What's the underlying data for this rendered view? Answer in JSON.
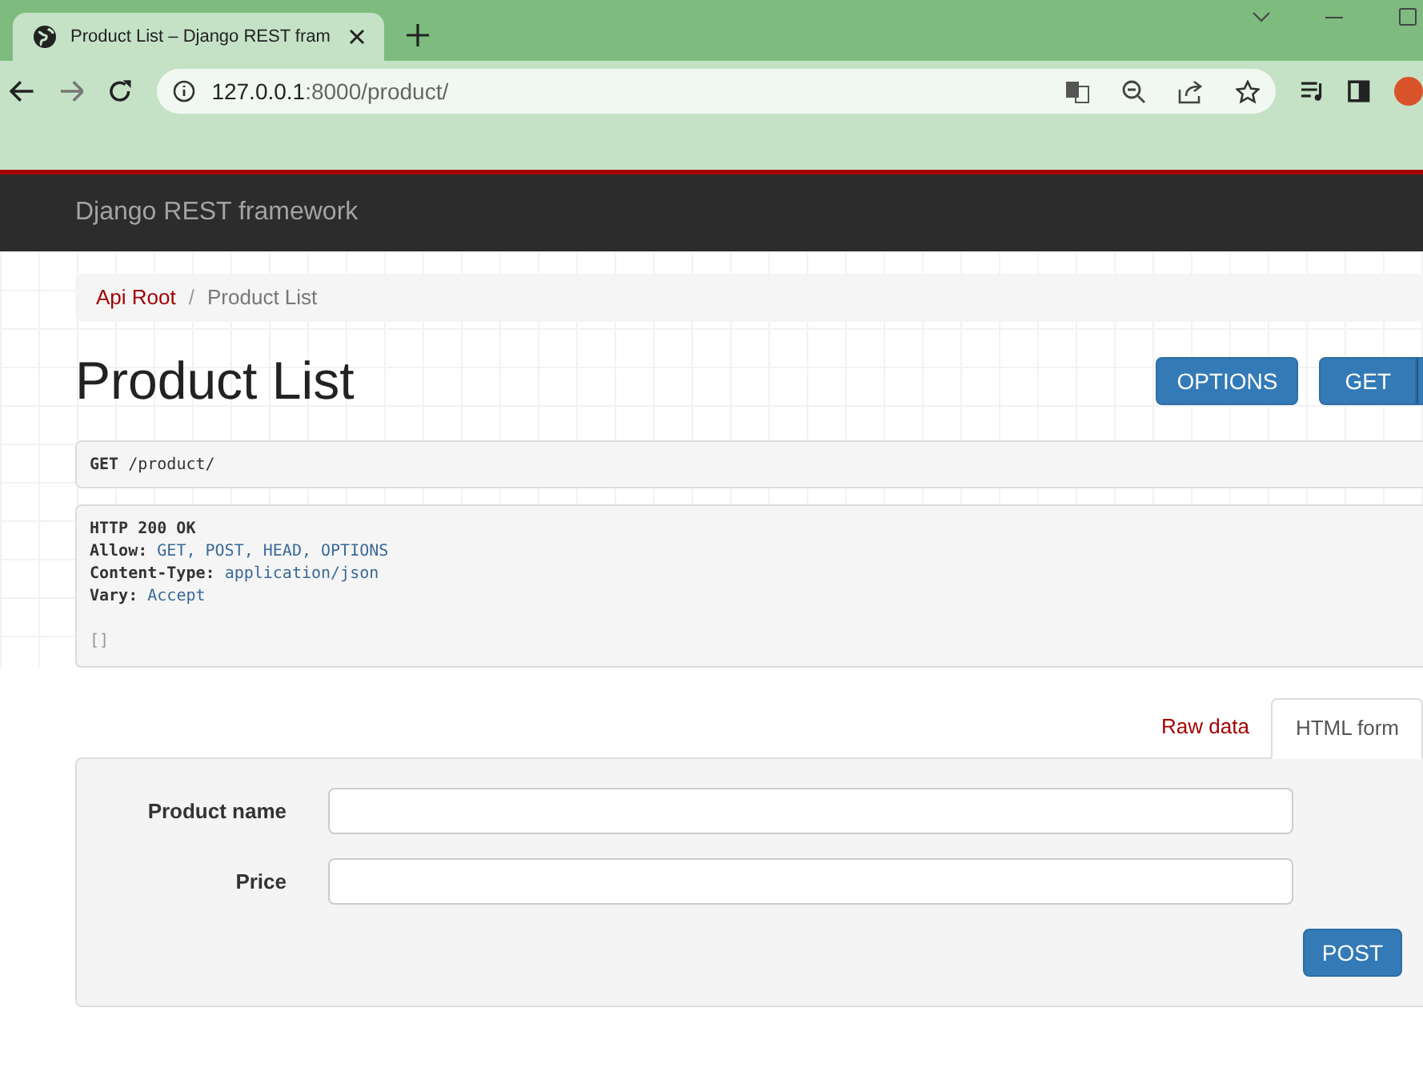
{
  "browser": {
    "tab_title": "Product List – Django REST fram",
    "url_host": "127.0.0.1",
    "url_path": ":8000/product/"
  },
  "navbar": {
    "brand": "Django REST framework"
  },
  "breadcrumb_separator": "/",
  "breadcrumbs": [
    {
      "label": "Api Root",
      "selected": false
    },
    {
      "label": "Product List",
      "selected": true
    }
  ],
  "title": "Product List",
  "actions": [
    {
      "label": "OPTIONS",
      "kind": "plain"
    },
    {
      "label": "GET",
      "kind": "split"
    }
  ],
  "request": {
    "method": "GET",
    "path": "/product/"
  },
  "response": {
    "status": "HTTP 200 OK",
    "headers": [
      {
        "name": "Allow:",
        "value": "GET, POST, HEAD, OPTIONS"
      },
      {
        "name": "Content-Type:",
        "value": "application/json"
      },
      {
        "name": "Vary:",
        "value": "Accept"
      }
    ],
    "body": "[]"
  },
  "tabs": [
    {
      "label": "Raw data",
      "selected": false
    },
    {
      "label": "HTML form",
      "selected": true
    }
  ],
  "form": {
    "fields": [
      {
        "label": "Product name"
      },
      {
        "label": "Price"
      }
    ],
    "submit": "POST"
  }
}
